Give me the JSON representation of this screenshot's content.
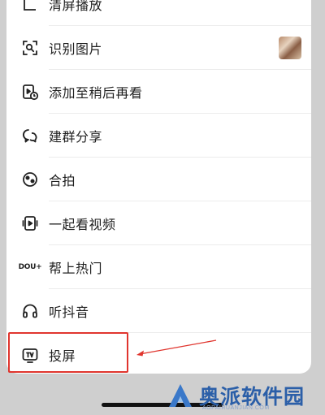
{
  "menu": {
    "items": [
      {
        "id": "clean-screen",
        "label": "清屏播放",
        "icon": "clean-screen-icon"
      },
      {
        "id": "identify-image",
        "label": "识别图片",
        "icon": "scan-image-icon"
      },
      {
        "id": "watch-later",
        "label": "添加至稍后再看",
        "icon": "watch-later-icon"
      },
      {
        "id": "group-share",
        "label": "建群分享",
        "icon": "group-chat-icon"
      },
      {
        "id": "duet",
        "label": "合拍",
        "icon": "duet-icon"
      },
      {
        "id": "watch-together",
        "label": "一起看视频",
        "icon": "watch-together-icon"
      },
      {
        "id": "dou-plus",
        "label": "帮上热门",
        "icon": "dou-plus-icon",
        "icon_text": "DOU+"
      },
      {
        "id": "listen",
        "label": "听抖音",
        "icon": "headphones-icon"
      },
      {
        "id": "cast",
        "label": "投屏",
        "icon": "tv-cast-icon"
      }
    ]
  },
  "watermark": {
    "text": "奥派软件园",
    "sub": "AOPAIRUANJIAN.COM"
  },
  "colors": {
    "highlight": "#e0352e",
    "watermark": "#2b5fa8"
  }
}
